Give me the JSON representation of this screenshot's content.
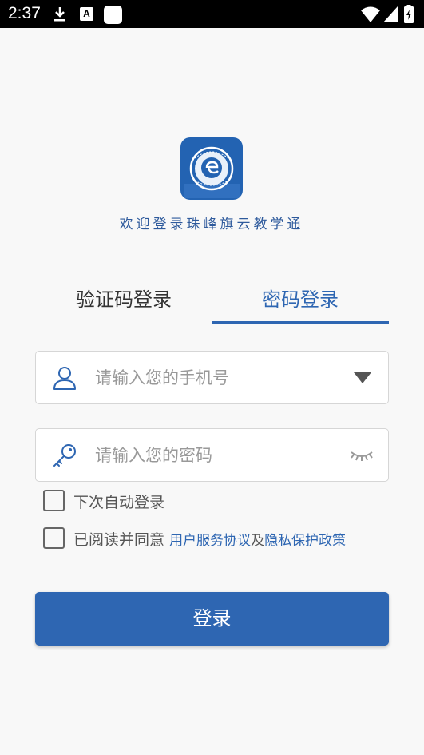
{
  "status_bar": {
    "time": "2:37",
    "notification_a": "A"
  },
  "app": {
    "welcome_text": "欢迎登录珠峰旗云教学通"
  },
  "tabs": [
    {
      "label": "验证码登录",
      "active": false
    },
    {
      "label": "密码登录",
      "active": true
    }
  ],
  "form": {
    "phone_placeholder": "请输入您的手机号",
    "phone_value": "",
    "password_placeholder": "请输入您的密码",
    "password_value": ""
  },
  "options": {
    "auto_login_label": "下次自动登录",
    "auto_login_checked": false,
    "agree_prefix": "已阅读并同意",
    "user_agreement_link": "用户服务协议",
    "conjunction": "及",
    "privacy_policy_link": "隐私保护政策",
    "agree_checked": false
  },
  "login_button_label": "登录",
  "colors": {
    "primary": "#2e66b2",
    "logo_bg": "#2363b2",
    "background": "#f8f8f8"
  }
}
